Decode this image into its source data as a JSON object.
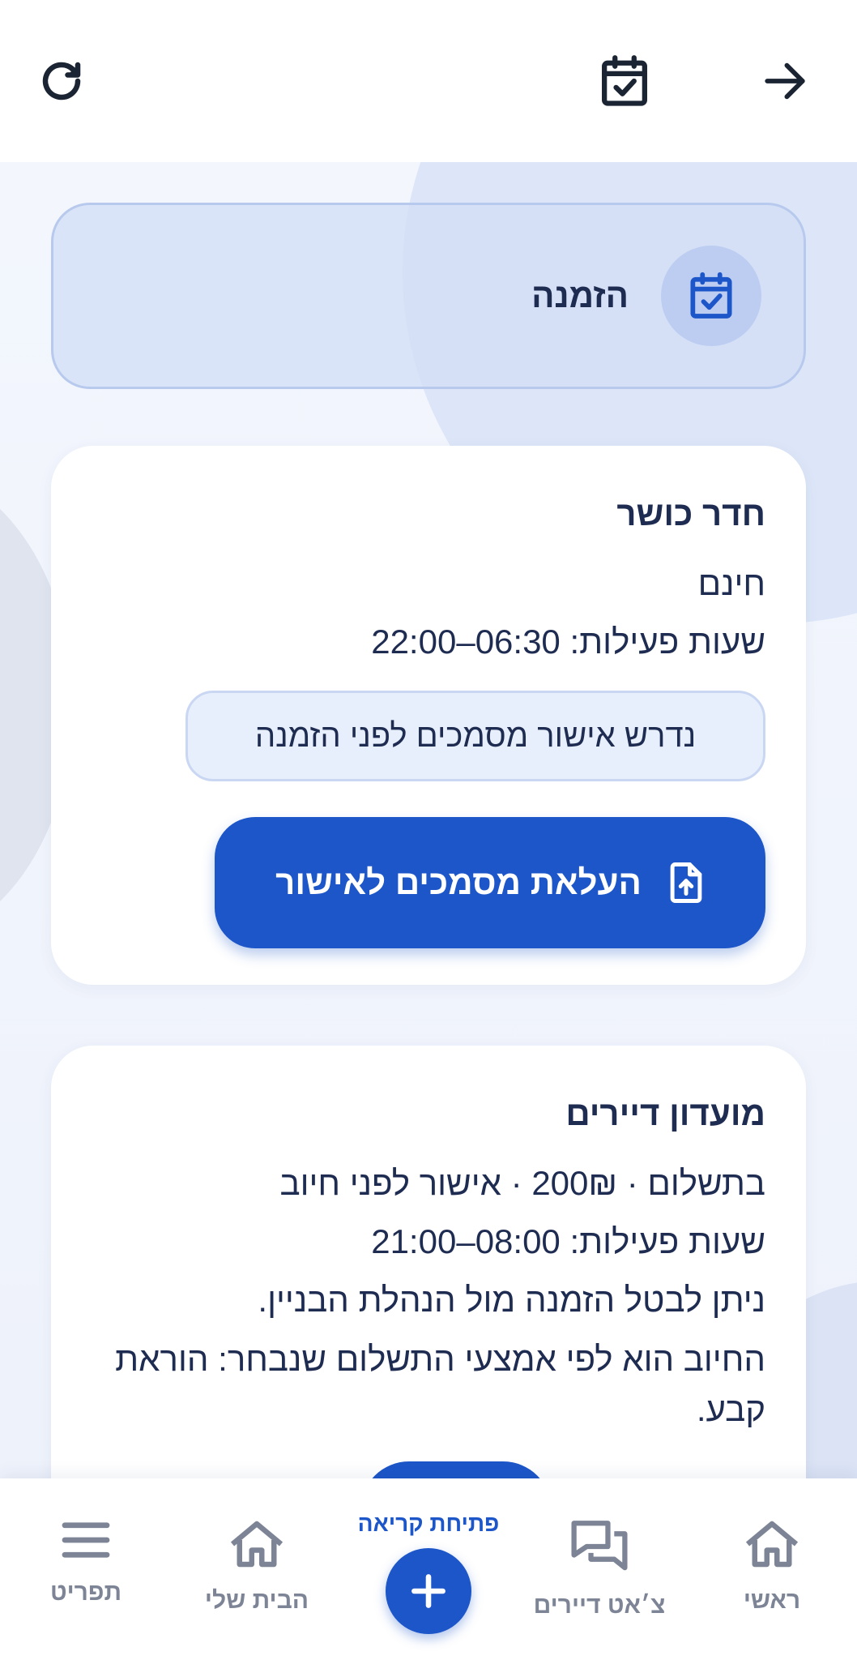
{
  "colors": {
    "primary": "#1c56c8",
    "text_dark": "#1f2c52",
    "nav_gray": "#7c8496"
  },
  "header": {
    "refresh_icon": "refresh-icon",
    "calendar_icon": "calendar-check-icon",
    "back_icon": "arrow-right-icon"
  },
  "hero": {
    "title": "הזמנה",
    "icon": "calendar-check-icon"
  },
  "facilities": [
    {
      "name": "חדר כושר",
      "price": "חינם",
      "hours": "שעות פעילות: 06:30–22:00",
      "notice": "נדרש אישור מסמכים לפני הזמנה",
      "upload_label": "העלאת מסמכים לאישור",
      "upload_icon": "file-upload-icon"
    },
    {
      "name": "מועדון דיירים",
      "price_line": "בתשלום · 200₪ · אישור לפני חיוב",
      "hours": "שעות פעילות: 08:00–21:00",
      "cancel_note": "ניתן לבטל הזמנה מול הנהלת הבניין.",
      "billing_note": "החיוב הוא לפי אמצעי התשלום שנבחר: הוראת קבע."
    }
  ],
  "bottom_nav": {
    "home": "ראשי",
    "chat": "צ׳אט דיירים",
    "open_call": "פתיחת קריאה",
    "my_home": "הבית שלי",
    "menu": "תפריט"
  }
}
